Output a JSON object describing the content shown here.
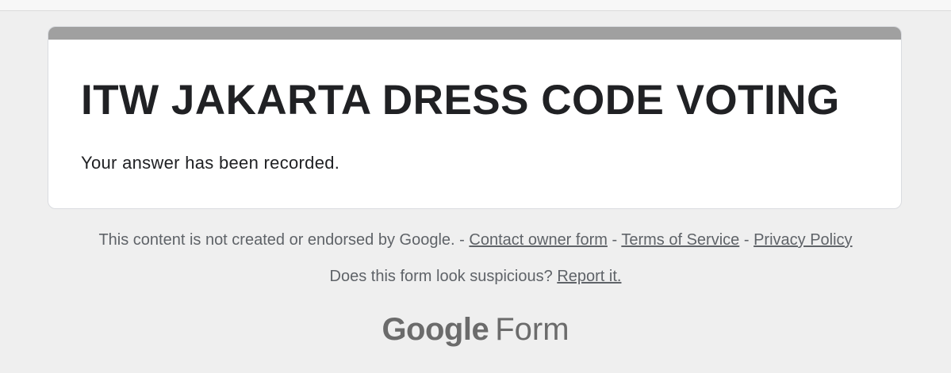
{
  "form": {
    "title": "ITW JAKARTA DRESS CODE VOTING",
    "confirmation": "Your answer has been recorded."
  },
  "footer": {
    "disclaimer": "This content is not created or endorsed by Google.",
    "separator": "-",
    "contact_link": "Contact owner form",
    "terms_link": "Terms of Service",
    "privacy_link": "Privacy Policy",
    "suspicious_text": "Does this form look suspicious?",
    "report_link": "Report it."
  },
  "brand": {
    "google": "Google",
    "product": "Form"
  },
  "colors": {
    "page_background": "#efefef",
    "card_accent": "#a0a0a0",
    "text": "#202124",
    "muted_text": "#5f6368"
  }
}
